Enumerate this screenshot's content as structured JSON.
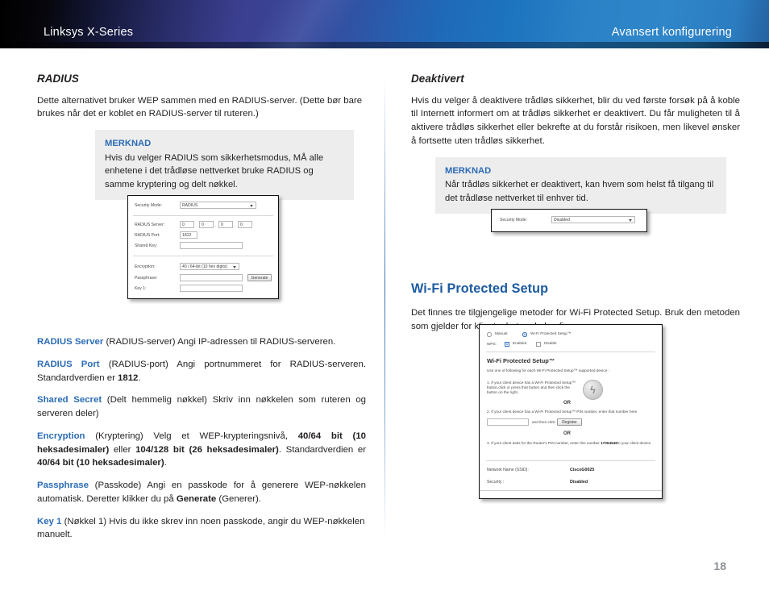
{
  "header": {
    "product": "Linksys X-Series",
    "section": "Avansert konfigurering"
  },
  "left_column": {
    "heading": "RADIUS",
    "intro": "Dette alternativet bruker WEP sammen med en RADIUS-server. (Dette bør bare brukes når det er koblet en RADIUS-server til ruteren.)",
    "note": {
      "title": "MERKNAD",
      "text": "Hvis du velger RADIUS som sikkerhetsmodus, MÅ alle enhetene i det trådløse nettverket bruke RADIUS og samme kryptering og delt nøkkel."
    },
    "terms": [
      {
        "term": "RADIUS Server",
        "text_1": " (RADIUS-server)  Angi IP-adressen til RADIUS-serveren."
      },
      {
        "term": "RADIUS Port",
        "text_1": " (RADIUS-port) Angi portnummeret for RADIUS-serveren. Standardverdien er ",
        "bold_1": "1812",
        "text_2": "."
      },
      {
        "term": "Shared Secret",
        "text_1": " (Delt hemmelig nøkkel) Skriv inn nøkkelen som ruteren og serveren deler)"
      },
      {
        "term": "Encryption",
        "text_1": " (Kryptering) Velg et WEP-krypteringsnivå, ",
        "bold_1": "40/64 bit (10 heksadesimaler)",
        "text_2": " eller ",
        "bold_2": "104/128 bit (26 heksadesimaler)",
        "text_3": ". Standardverdien er ",
        "bold_3": "40/64 bit (10 heksadesimaler)",
        "text_4": "."
      },
      {
        "term": "Passphrase",
        "text_1": " (Passkode) Angi en passkode for å generere WEP-nøkkelen automatisk. Deretter klikker du på ",
        "bold_1": "Generate",
        "text_2": " (Generer)."
      },
      {
        "term": "Key 1",
        "text_1": " (Nøkkel 1)  Hvis du ikke skrev inn noen passkode, angir du WEP-nøkkelen manuelt."
      }
    ]
  },
  "right_column": {
    "heading": "Deaktivert",
    "intro": "Hvis du velger å deaktivere trådløs sikkerhet, blir du ved første forsøk på å koble til Internett informert om at trådløs sikkerhet er deaktivert. Du får muligheten til å aktivere trådløs sikkerhet eller bekrefte at du forstår risikoen, men likevel ønsker å fortsette uten trådløs sikkerhet.",
    "note": {
      "title": "MERKNAD",
      "text": "Når trådløs sikkerhet er deaktivert, kan hvem som helst få tilgang til det trådløse nettverket til enhver tid."
    },
    "wps_heading": "Wi-Fi Protected Setup",
    "wps_intro": "Det finnes tre tilgjengelige metoder for Wi-Fi Protected Setup. Bruk den metoden som gjelder for klientenheten du konfigurerer."
  },
  "figure_radius": {
    "security_mode_label": "Security Mode:",
    "security_mode_value": "RADIUS",
    "radius_server_label": "RADIUS Server:",
    "radius_server_octets": [
      "0",
      "0",
      "0",
      "0"
    ],
    "radius_port_label": "RADIUS Port:",
    "radius_port_value": "1812",
    "shared_key_label": "Shared Key:",
    "shared_key_value": "",
    "encryption_label": "Encryption:",
    "encryption_value": "40 / 64-bit (10 hex digits)",
    "passphrase_label": "Passphrase:",
    "passphrase_value": "",
    "generate_button": "Generate",
    "key1_label": "Key 1:",
    "key1_value": ""
  },
  "figure_disabled": {
    "security_mode_label": "Security Mode:",
    "security_mode_value": "Disabled"
  },
  "figure_wps": {
    "radio_manual": "Manual",
    "radio_wps": "Wi-Fi Protected Setup™",
    "wps_field_label": "WPS:",
    "radio_enabled": "Enabled",
    "radio_disable": "Disable",
    "title": "Wi-Fi Protected Setup™",
    "subtitle": "Use one of following  for each Wi-Fi Protected Setup™  supported device :",
    "step1": "1. If your client device has a Wi-Fi Protected Setup™ button,click or press that button and then click the button on the right.",
    "or_1": "OR",
    "step2": "2. If your client device has a Wi-Fi Protected Setup™ PIN number, enter that number here",
    "step2_after": "and then click",
    "register_button": "Register",
    "pin_input_value": "",
    "or_2": "OR",
    "step3_a": "3. If your client asks for the Router's PIN number, enter this number ",
    "step3_pin": "17064549",
    "step3_b": "in your client device.",
    "ssid_label": "Network Name (SSID):",
    "ssid_value": "CiscoG0025",
    "security_label": "Security :",
    "security_value": "Disabled",
    "wps_icon": "wifi-protected-setup-icon"
  },
  "footer": {
    "page_number": "18"
  }
}
